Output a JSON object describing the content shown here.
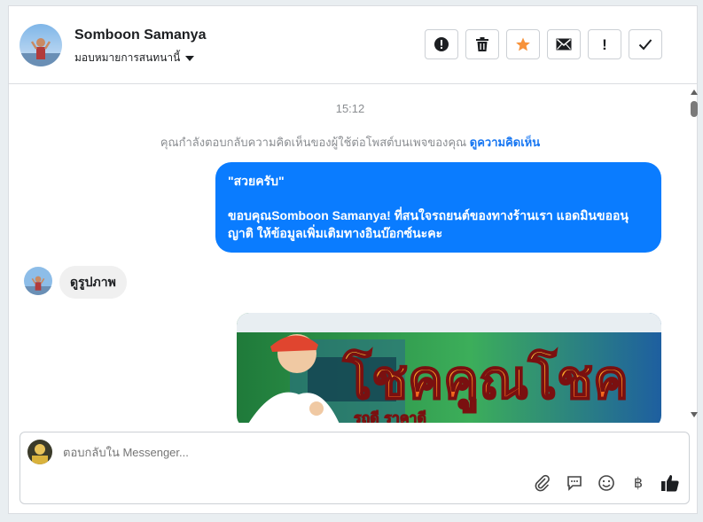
{
  "header": {
    "name": "Somboon Samanya",
    "assign_label": "มอบหมายการสนทนานี้",
    "actions": [
      "report-icon",
      "trash-icon",
      "star-icon",
      "mail-icon",
      "exclamation-icon",
      "check-icon"
    ],
    "exclamation_glyph": "!"
  },
  "conversation": {
    "timestamp": "15:12",
    "notice_text": "คุณกำลังตอบกลับความคิดเห็นของผู้ใช้ต่อโพสต์บนเพจของคุณ",
    "notice_link": "ดูความคิดเห็น",
    "outgoing_quote": "\"สวยครับ\"",
    "outgoing_body": "ขอบคุณSomboon Samanya! ที่สนใจรถยนต์ของทางร้านเรา แอดมินขออนุญาติ ให้ข้อมูลเพิ่มเติมทางอินบ๊อกซ์นะคะ",
    "incoming_text": "ดูรูปภาพ",
    "image_headline": "โชคคูณโชค",
    "image_subtext": "รถดี ราคาดี"
  },
  "composer": {
    "placeholder": "ตอบกลับใน Messenger...",
    "baht_symbol": "฿"
  },
  "colors": {
    "accent": "#0a7cff",
    "star": "#f7923a",
    "link": "#1877f2"
  }
}
